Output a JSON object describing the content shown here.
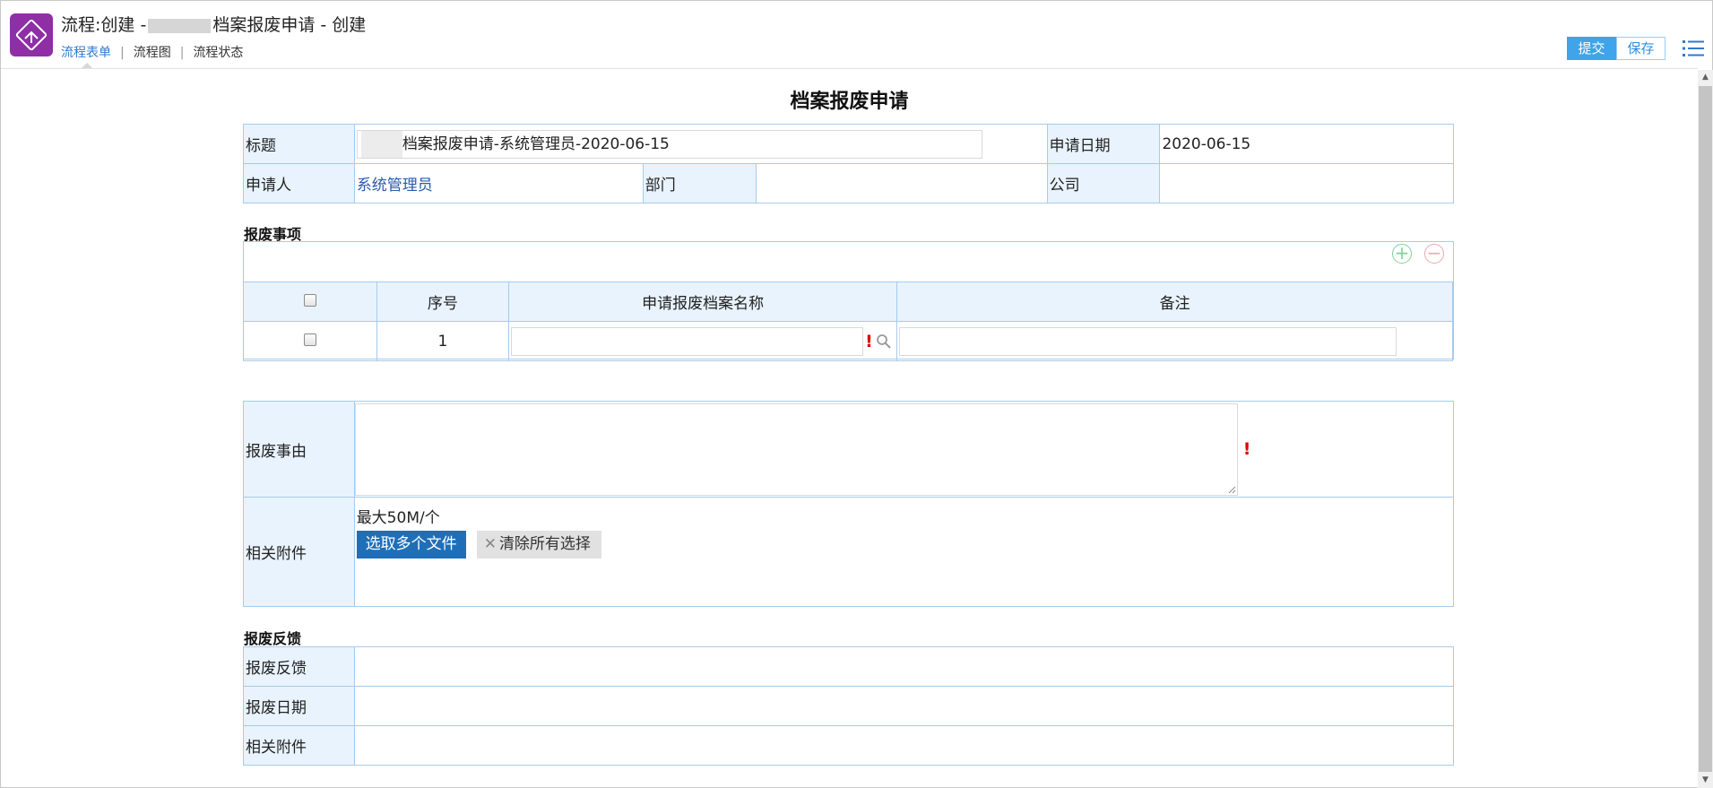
{
  "header": {
    "title_prefix": "流程:创建 -",
    "title_suffix": "档案报废申请 - 创建",
    "tabs": [
      "流程表单",
      "流程图",
      "流程状态"
    ],
    "submit_label": "提交",
    "save_label": "保存"
  },
  "form": {
    "title": "档案报废申请",
    "fields": {
      "title_label": "标题",
      "title_value": "档案报废申请-系统管理员-2020-06-15",
      "apply_date_label": "申请日期",
      "apply_date_value": "2020-06-15",
      "applicant_label": "申请人",
      "applicant_value": "系统管理员",
      "dept_label": "部门",
      "company_label": "公司"
    },
    "items_section": {
      "label": "报废事项",
      "columns": [
        "序号",
        "申请报废档案名称",
        "备注"
      ],
      "rows": [
        {
          "seq": "1",
          "name": "",
          "note": ""
        }
      ]
    },
    "reason_label": "报废事由",
    "attachment": {
      "label": "相关附件",
      "hint": "最大50M/个",
      "select_label": "选取多个文件",
      "clear_label": "清除所有选择"
    },
    "feedback_section": {
      "label": "报废反馈",
      "rows": [
        "报废反馈",
        "报废日期",
        "相关附件"
      ]
    }
  },
  "colors": {
    "accent": "#3fa4ea",
    "label_bg": "#e8f3fd",
    "border": "#a7cbea",
    "icon_bg": "#8e2fa6"
  }
}
